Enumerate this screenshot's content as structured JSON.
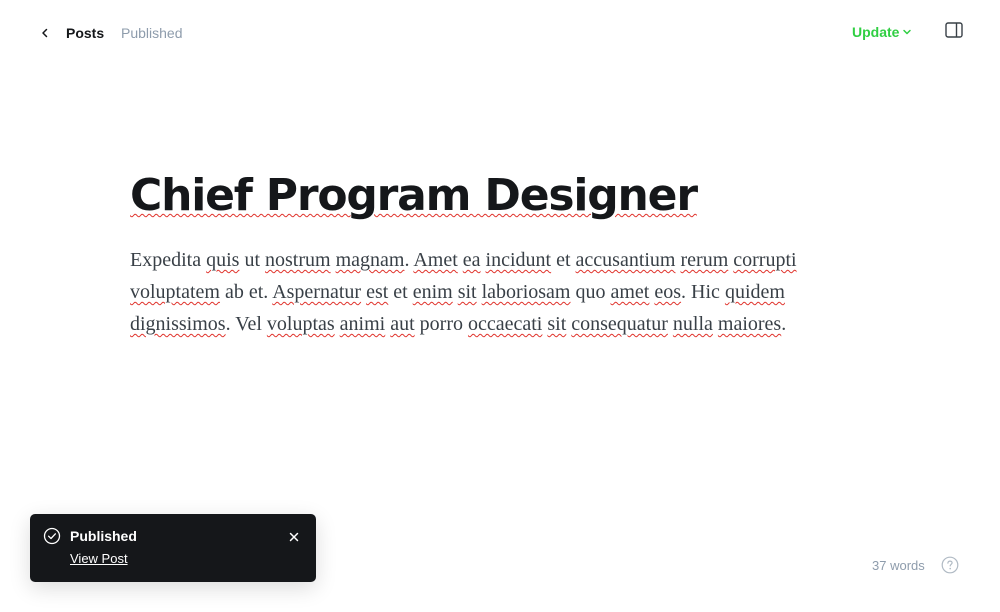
{
  "header": {
    "back_label": "Posts",
    "status": "Published",
    "update_label": "Update"
  },
  "post": {
    "title": "Chief Program Designer",
    "body_segments": [
      {
        "t": "Expedita ",
        "s": false
      },
      {
        "t": "quis",
        "s": true
      },
      {
        "t": " ut ",
        "s": false
      },
      {
        "t": "nostrum",
        "s": true
      },
      {
        "t": " ",
        "s": false
      },
      {
        "t": "magnam",
        "s": true
      },
      {
        "t": ". ",
        "s": false
      },
      {
        "t": "Amet",
        "s": true
      },
      {
        "t": " ",
        "s": false
      },
      {
        "t": "ea",
        "s": true
      },
      {
        "t": " ",
        "s": false
      },
      {
        "t": "incidunt",
        "s": true
      },
      {
        "t": " et ",
        "s": false
      },
      {
        "t": "accusantium",
        "s": true
      },
      {
        "t": " ",
        "s": false
      },
      {
        "t": "rerum",
        "s": true
      },
      {
        "t": " ",
        "s": false
      },
      {
        "t": "corrupti",
        "s": true
      },
      {
        "t": " ",
        "s": false
      },
      {
        "t": "voluptatem",
        "s": true
      },
      {
        "t": " ab et. ",
        "s": false
      },
      {
        "t": "Aspernatur",
        "s": true
      },
      {
        "t": " ",
        "s": false
      },
      {
        "t": "est",
        "s": true
      },
      {
        "t": " et ",
        "s": false
      },
      {
        "t": "enim",
        "s": true
      },
      {
        "t": " ",
        "s": false
      },
      {
        "t": "sit",
        "s": true
      },
      {
        "t": " ",
        "s": false
      },
      {
        "t": "laboriosam",
        "s": true
      },
      {
        "t": " quo ",
        "s": false
      },
      {
        "t": "amet",
        "s": true
      },
      {
        "t": " ",
        "s": false
      },
      {
        "t": "eos",
        "s": true
      },
      {
        "t": ". Hic ",
        "s": false
      },
      {
        "t": "quidem",
        "s": true
      },
      {
        "t": " ",
        "s": false
      },
      {
        "t": "dignissimos",
        "s": true
      },
      {
        "t": ". Vel ",
        "s": false
      },
      {
        "t": "voluptas",
        "s": true
      },
      {
        "t": " ",
        "s": false
      },
      {
        "t": "animi",
        "s": true
      },
      {
        "t": " ",
        "s": false
      },
      {
        "t": "aut",
        "s": true
      },
      {
        "t": " porro ",
        "s": false
      },
      {
        "t": "occaecati",
        "s": true
      },
      {
        "t": " ",
        "s": false
      },
      {
        "t": "sit",
        "s": true
      },
      {
        "t": " ",
        "s": false
      },
      {
        "t": "consequatur",
        "s": true
      },
      {
        "t": " ",
        "s": false
      },
      {
        "t": "nulla",
        "s": true
      },
      {
        "t": " ",
        "s": false
      },
      {
        "t": "maiores",
        "s": true
      },
      {
        "t": ".",
        "s": false
      }
    ]
  },
  "toast": {
    "title": "Published",
    "link_label": "View Post"
  },
  "footer": {
    "word_count": "37 words"
  },
  "icons": {
    "back": "chevron-left-icon",
    "update": "chevron-down-icon",
    "sidebar": "sidebar-toggle-icon",
    "toast_status": "check-circle-icon",
    "toast_close": "close-icon",
    "help": "help-icon"
  },
  "colors": {
    "accent_green": "#30cf43",
    "toast_bg": "#15171a",
    "muted": "#8e9cac",
    "spellcheck": "#e0322b"
  }
}
